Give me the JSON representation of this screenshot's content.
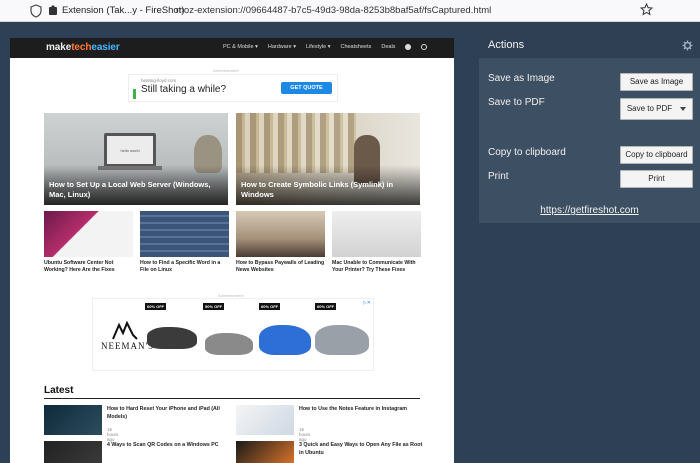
{
  "browser": {
    "tab_label": "Extension (Tak...y - FireShot)",
    "url": "moz-extension://09664487-b7c5-49d3-98da-8253b8baf5af/fsCaptured.html"
  },
  "site": {
    "logo": {
      "part1": "make",
      "part2": "tech",
      "part3": "easier"
    },
    "nav": [
      "PC & Mobile ▾",
      "Hardware ▾",
      "Lifestyle ▾",
      "Cheatsheets",
      "Deals"
    ],
    "ad_label": "Advertisement",
    "ad1": {
      "domain": "heating-lloyd.com",
      "title": "Still taking a while?",
      "cta": "GET QUOTE"
    },
    "featured": [
      {
        "caption": "How to Set Up a Local Web Server (Windows, Mac, Linux)",
        "screen_text": "hello world"
      },
      {
        "caption": "How to Create Symbolic Links (Symlink) in Windows"
      }
    ],
    "cards": [
      {
        "caption": "Ubuntu Software Center Not Working? Here Are the Fixes"
      },
      {
        "caption": "How to Find a Specific Word in a File on Linux"
      },
      {
        "caption": "How to Bypass Paywalls of Leading News Websites"
      },
      {
        "caption": "Mac Unable to Communicate With Your Printer? Try These Fixes"
      }
    ],
    "ad2": {
      "brand": "NEEMAN'S",
      "tags": [
        "60% OFF",
        "50% OFF",
        "60% OFF",
        "60% OFF"
      ]
    },
    "latest": {
      "heading": "Latest",
      "items": [
        {
          "title": "How to Hard Reset Your iPhone and iPad (All Models)",
          "date": "15 hours ago"
        },
        {
          "title": "How to Use the Notes Feature in Instagram",
          "date": "15 hours ago"
        },
        {
          "title": "4 Ways to Scan QR Codes on a Windows PC",
          "date": ""
        },
        {
          "title": "3 Quick and Easy Ways to Open Any File as Root in Ubuntu",
          "date": ""
        }
      ]
    }
  },
  "panel": {
    "title": "Actions",
    "save_image_label": "Save as Image",
    "save_image_button": "Save as Image",
    "save_pdf_label": "Save to PDF",
    "save_pdf_button": "Save to PDF",
    "copy_label": "Copy to clipboard",
    "copy_button": "Copy to clipboard",
    "print_label": "Print",
    "print_button": "Print",
    "link": "https://getfireshot.com"
  },
  "colors": {
    "background": "#2e4055",
    "panel": "#3d4f63",
    "panel_header": "#2f4054",
    "cta": "#1e88e5"
  }
}
